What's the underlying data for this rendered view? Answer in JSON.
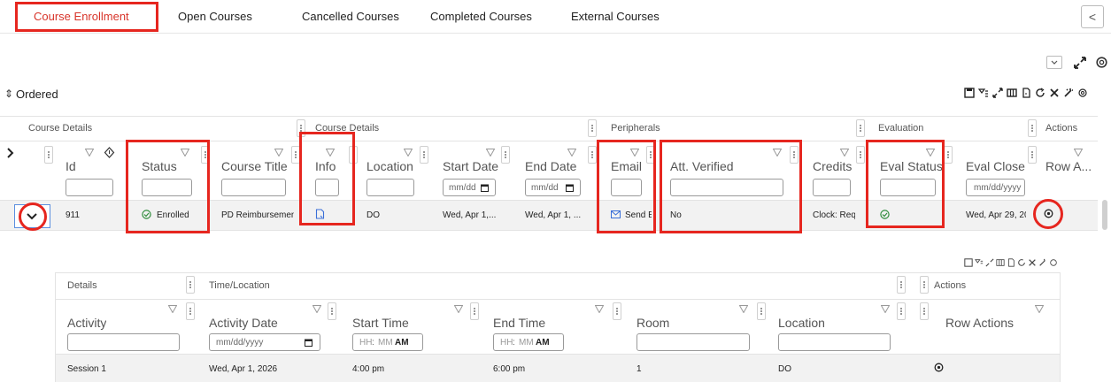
{
  "tabs": [
    {
      "label": "Course Enrollment"
    },
    {
      "label": "Open Courses"
    },
    {
      "label": "Cancelled Courses"
    },
    {
      "label": "Completed Courses"
    },
    {
      "label": "External Courses"
    }
  ],
  "collapse_glyph": "<",
  "section_title": "Ordered",
  "sort_glyph": "⇕",
  "groups": {
    "course_details_1": "Course Details",
    "course_details_2": "Course Details",
    "peripherals": "Peripherals",
    "evaluation": "Evaluation",
    "actions": "Actions"
  },
  "columns": {
    "id": "Id",
    "status": "Status",
    "course_title": "Course Title",
    "info": "Info",
    "location": "Location",
    "start_date": "Start Date",
    "end_date": "End Date",
    "email": "Email",
    "att_verified": "Att. Verified",
    "credits": "Credits",
    "eval_status": "Eval Status",
    "eval_close": "Eval Close D",
    "row_actions": "Row A..."
  },
  "filters": {
    "date_placeholder_short": "mm/dd",
    "date_placeholder": "mm/dd/yyyy"
  },
  "row": {
    "id": "911",
    "status": "Enrolled",
    "course_title": "PD Reimbursement",
    "location": "DO",
    "start_date": "Wed, Apr 1,...",
    "end_date": "Wed, Apr 1, ...",
    "email": "Send E",
    "att_verified": "No",
    "credits": "Clock: Reque",
    "eval_close": "Wed, Apr 29, 20"
  },
  "sub": {
    "groups": {
      "details": "Details",
      "time_location": "Time/Location",
      "actions": "Actions"
    },
    "columns": {
      "activity": "Activity",
      "activity_date": "Activity Date",
      "start_time": "Start Time",
      "end_time": "End Time",
      "room": "Room",
      "location": "Location",
      "row_actions": "Row Actions"
    },
    "filters": {
      "date_placeholder": "mm/dd/yyyy",
      "hh": "HH",
      "mm": "MM",
      "ampm": "AM"
    },
    "row": {
      "activity": "Session 1",
      "activity_date": "Wed, Apr 1, 2026",
      "start_time": "4:00 pm",
      "end_time": "6:00 pm",
      "room": "1",
      "location": "DO"
    }
  },
  "colors": {
    "accent_red": "#e6261f",
    "active_tab": "#d8342a",
    "link_blue": "#3a6fd8",
    "ok_green": "#2e8b3a"
  }
}
